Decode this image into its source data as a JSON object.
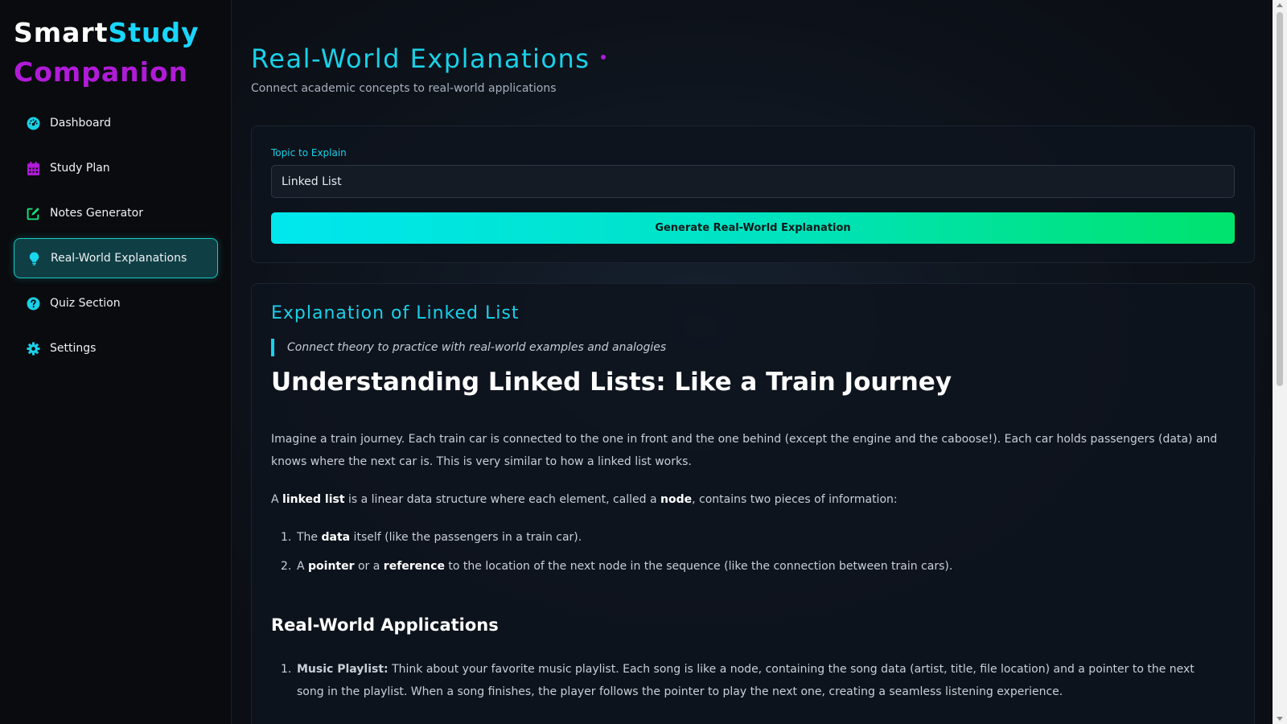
{
  "brand": {
    "word1": "Smart",
    "word2": "Study",
    "line2": "Companion"
  },
  "colors": {
    "accent_cyan": "#19d1e8",
    "accent_purple": "#b01bd8",
    "button_gradient_start": "#00e7ee",
    "button_gradient_end": "#00e36c"
  },
  "sidebar": {
    "items": [
      {
        "label": "Dashboard",
        "icon": "dashboard-icon",
        "active": false
      },
      {
        "label": "Study Plan",
        "icon": "calendar-icon",
        "active": false
      },
      {
        "label": "Notes Generator",
        "icon": "edit-icon",
        "active": false
      },
      {
        "label": "Real-World Explanations",
        "icon": "lightbulb-icon",
        "active": true
      },
      {
        "label": "Quiz Section",
        "icon": "question-icon",
        "active": false
      },
      {
        "label": "Settings",
        "icon": "gear-icon",
        "active": false
      }
    ]
  },
  "header": {
    "title": "Real-World Explanations",
    "subtitle": "Connect academic concepts to real-world applications"
  },
  "form": {
    "label": "Topic to Explain",
    "value": "Linked List",
    "button_label": "Generate Real-World Explanation"
  },
  "explanation": {
    "title": "Explanation of Linked List",
    "tagline": "Connect theory to practice with real-world examples and analogies",
    "heading": "Understanding Linked Lists: Like a Train Journey",
    "intro": "Imagine a train journey. Each train car is connected to the one in front and the one behind (except the engine and the caboose!). Each car holds passengers (data) and knows where the next car is. This is very similar to how a linked list works.",
    "def_p1": "A ",
    "def_b1": "linked list",
    "def_p2": " is a linear data structure where each element, called a ",
    "def_b2": "node",
    "def_p3": ", contains two pieces of information:",
    "list": [
      {
        "num": "1.",
        "pre": "The ",
        "bold": "data",
        "post": " itself (like the passengers in a train car)."
      },
      {
        "num": "2.",
        "pre": "A ",
        "bold": "pointer",
        "mid": " or a ",
        "bold2": "reference",
        "post": " to the location of the next node in the sequence (like the connection between train cars)."
      }
    ],
    "applications_heading": "Real-World Applications",
    "applications": [
      {
        "num": "1.",
        "title": "Music Playlist:",
        "text": " Think about your favorite music playlist. Each song is like a node, containing the song data (artist, title, file location) and a pointer to the next song in the playlist. When a song finishes, the player follows the pointer to play the next one, creating a seamless listening experience."
      }
    ]
  }
}
